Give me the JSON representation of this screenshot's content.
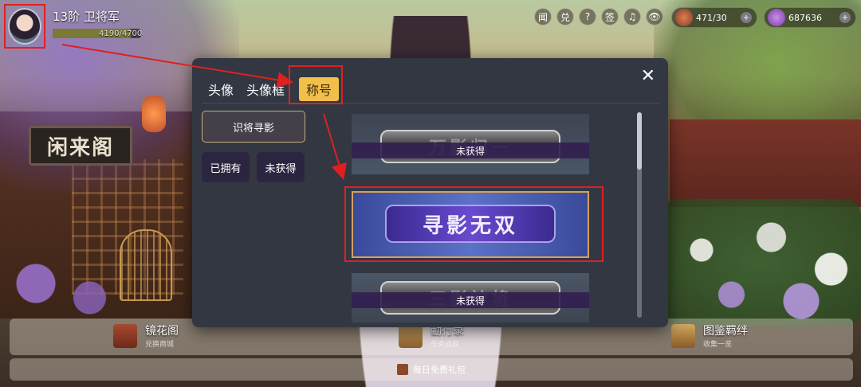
{
  "player": {
    "title": "13阶 卫将军",
    "exp_text": "4190/4700",
    "exp_fraction": 0.89
  },
  "hud": {
    "icons": [
      {
        "label": "闻",
        "name": "news-icon"
      },
      {
        "label": "兑",
        "name": "exchange-icon"
      },
      {
        "label": "?",
        "name": "help-icon"
      },
      {
        "label": "签",
        "name": "signin-icon"
      },
      {
        "label": "♫",
        "name": "music-icon"
      },
      {
        "label": "👁",
        "name": "eye-icon"
      }
    ],
    "currency_1": {
      "value": "471/30",
      "icon": "money-bag-icon"
    },
    "currency_2": {
      "value": "687636",
      "icon": "purple-bag-icon"
    }
  },
  "background": {
    "sign_text": "闲来阁"
  },
  "modal": {
    "tabs": [
      {
        "label": "头像",
        "active": false
      },
      {
        "label": "头像框",
        "active": false
      },
      {
        "label": "称号",
        "active": true
      }
    ],
    "filters": {
      "main": "识将寻影",
      "owned": "已拥有",
      "not_obtained": "未获得"
    },
    "titles": [
      {
        "name": "万影归一",
        "status": "未获得",
        "locked": true
      },
      {
        "name": "寻影无双",
        "status": "",
        "locked": false,
        "selected": true
      },
      {
        "name": "三影神将",
        "status": "未获得",
        "locked": true
      }
    ],
    "close_icon": "close-icon"
  },
  "bottom": {
    "items": [
      {
        "title": "镜花阁",
        "sub": "兑换商城"
      },
      {
        "title": "勤行录",
        "sub": "任务成就"
      },
      {
        "title": "图鉴羁绊",
        "sub": "收集一览"
      }
    ],
    "gift_text": "每日免费礼包"
  },
  "colors": {
    "accent_tab": "#f2c04a",
    "annotation": "#e02020",
    "modal_bg": "#323742"
  }
}
